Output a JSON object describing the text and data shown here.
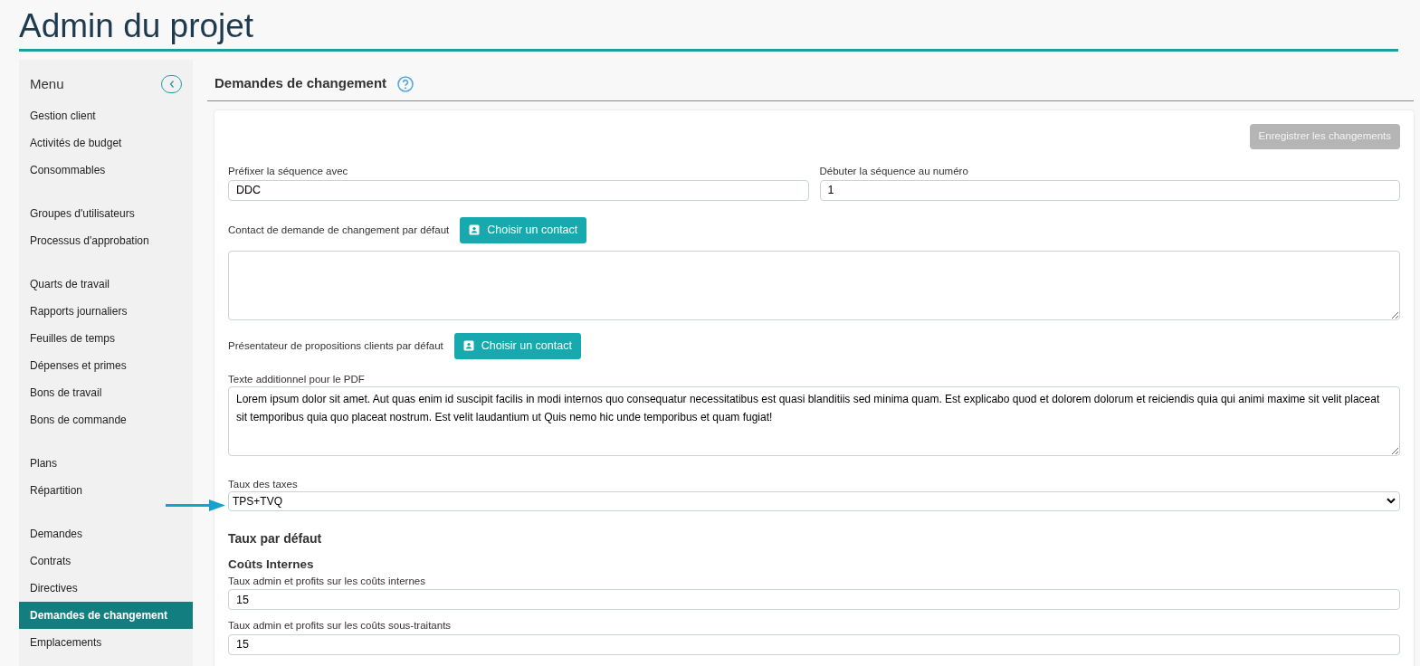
{
  "page_title": "Admin du projet",
  "sidebar": {
    "title": "Menu",
    "groups": [
      [
        {
          "label": "Gestion client",
          "selected": false
        },
        {
          "label": "Activités de budget",
          "selected": false
        },
        {
          "label": "Consommables",
          "selected": false
        }
      ],
      [
        {
          "label": "Groupes d'utilisateurs",
          "selected": false
        },
        {
          "label": "Processus d'approbation",
          "selected": false
        }
      ],
      [
        {
          "label": "Quarts de travail",
          "selected": false
        },
        {
          "label": "Rapports journaliers",
          "selected": false
        },
        {
          "label": "Feuilles de temps",
          "selected": false
        },
        {
          "label": "Dépenses et primes",
          "selected": false
        },
        {
          "label": "Bons de travail",
          "selected": false
        },
        {
          "label": "Bons de commande",
          "selected": false
        }
      ],
      [
        {
          "label": "Plans",
          "selected": false
        },
        {
          "label": "Répartition",
          "selected": false
        }
      ],
      [
        {
          "label": "Demandes",
          "selected": false
        },
        {
          "label": "Contrats",
          "selected": false
        },
        {
          "label": "Directives",
          "selected": false
        },
        {
          "label": "Demandes de changement",
          "selected": true
        },
        {
          "label": "Emplacements",
          "selected": false
        }
      ]
    ]
  },
  "section_title": "Demandes de changement",
  "save_button": {
    "label": "Enregistrer les changements",
    "disabled": true
  },
  "prefix": {
    "label": "Préfixer la séquence avec",
    "value": "DDC"
  },
  "start": {
    "label": "Débuter la séquence au numéro",
    "value": "1"
  },
  "contact": {
    "label": "Contact de demande de changement par défaut",
    "button": "Choisir un contact"
  },
  "presenter": {
    "label": "Présentateur de propositions clients par défaut",
    "button": "Choisir un contact"
  },
  "pdf_text": {
    "label": "Texte additionnel pour le PDF",
    "value": "Lorem ipsum dolor sit amet. Aut quas enim id suscipit facilis in modi internos quo consequatur necessitatibus est quasi blanditiis sed minima quam. Est explicabo quod et dolorem dolorum et reiciendis quia qui animi maxime sit velit placeat sit temporibus quia quo placeat nostrum. Est velit laudantium ut Quis nemo hic unde temporibus et quam fugiat!"
  },
  "tax": {
    "label": "Taux des taxes",
    "value": "TPS+TVQ"
  },
  "default_rates_title": "Taux par défaut",
  "internal_costs_title": "Coûts Internes",
  "rates": [
    {
      "label": "Taux admin et profits sur les coûts internes",
      "value": "15"
    },
    {
      "label": "Taux admin et profits sur les coûts sous-traitants",
      "value": "15"
    }
  ]
}
